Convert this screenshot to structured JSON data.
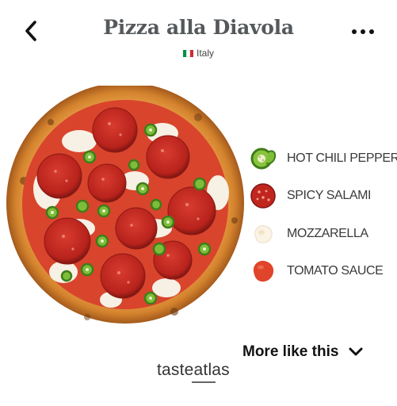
{
  "header": {
    "title": "Pizza alla Diavola",
    "country": "Italy",
    "back_icon": "chevron-left-icon",
    "menu_icon": "more-horizontal-icon"
  },
  "flag_colors": [
    "#009246",
    "#ffffff",
    "#ce2b37"
  ],
  "legend": {
    "items": [
      {
        "label": "HOT CHILI PEPPERS",
        "icon": "chili-pepper-icon"
      },
      {
        "label": "SPICY SALAMI",
        "icon": "salami-icon"
      },
      {
        "label": "MOZZARELLA",
        "icon": "mozzarella-icon"
      },
      {
        "label": "TOMATO SAUCE",
        "icon": "tomato-sauce-icon"
      }
    ]
  },
  "footer": {
    "more_like_label": "More like this",
    "more_icon": "chevron-down-icon",
    "brand": "tasteatlas"
  }
}
